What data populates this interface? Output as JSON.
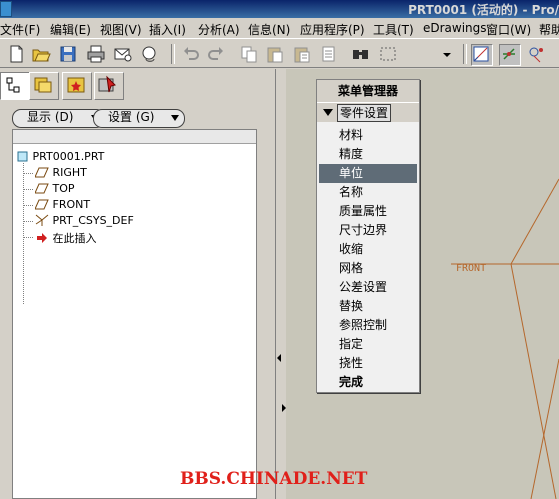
{
  "titlebar": {
    "title": "PRT0001 (活动的) - Pro/"
  },
  "menubar": [
    "文件(F)",
    "编辑(E)",
    "视图(V)",
    "插入(I)",
    "分析(A)",
    "信息(N)",
    "应用程序(P)",
    "工具(T)",
    "eDrawings",
    "窗口(W)",
    "帮助"
  ],
  "toolbar": {
    "icons": [
      "new-icon",
      "open-icon",
      "save-icon",
      "print-icon",
      "email-icon",
      "email-link-icon",
      "undo-icon",
      "redo-icon",
      "copy-icon",
      "paste-icon",
      "paste-special-icon",
      "delete-icon",
      "find-icon",
      "select-box-icon",
      "dropdown-icon",
      "datum-display-icon",
      "axis-display-icon",
      "point-display-icon"
    ]
  },
  "left_tabs": [
    "model-tree-tab-icon",
    "folder-tab-icon",
    "favorites-tab-icon",
    "connections-tab-icon"
  ],
  "display_button": "显示 (D)",
  "settings_button": "设置 (G)",
  "tree": {
    "root": "PRT0001.PRT",
    "items": [
      "RIGHT",
      "TOP",
      "FRONT",
      "PRT_CSYS_DEF",
      "在此插入"
    ]
  },
  "menu_manager": {
    "title": "菜单管理器",
    "submenu": "零件设置",
    "items": [
      "材料",
      "精度",
      "单位",
      "名称",
      "质量属性",
      "尺寸边界",
      "收缩",
      "网格",
      "公差设置",
      "替换",
      "参照控制",
      "指定",
      "挠性",
      "完成"
    ],
    "selected": "单位",
    "bold_item": "完成"
  },
  "graphics": {
    "datum_label": "FRONT",
    "datum_color": "#b5672b"
  },
  "watermark": "BBS.CHINADE.NET"
}
